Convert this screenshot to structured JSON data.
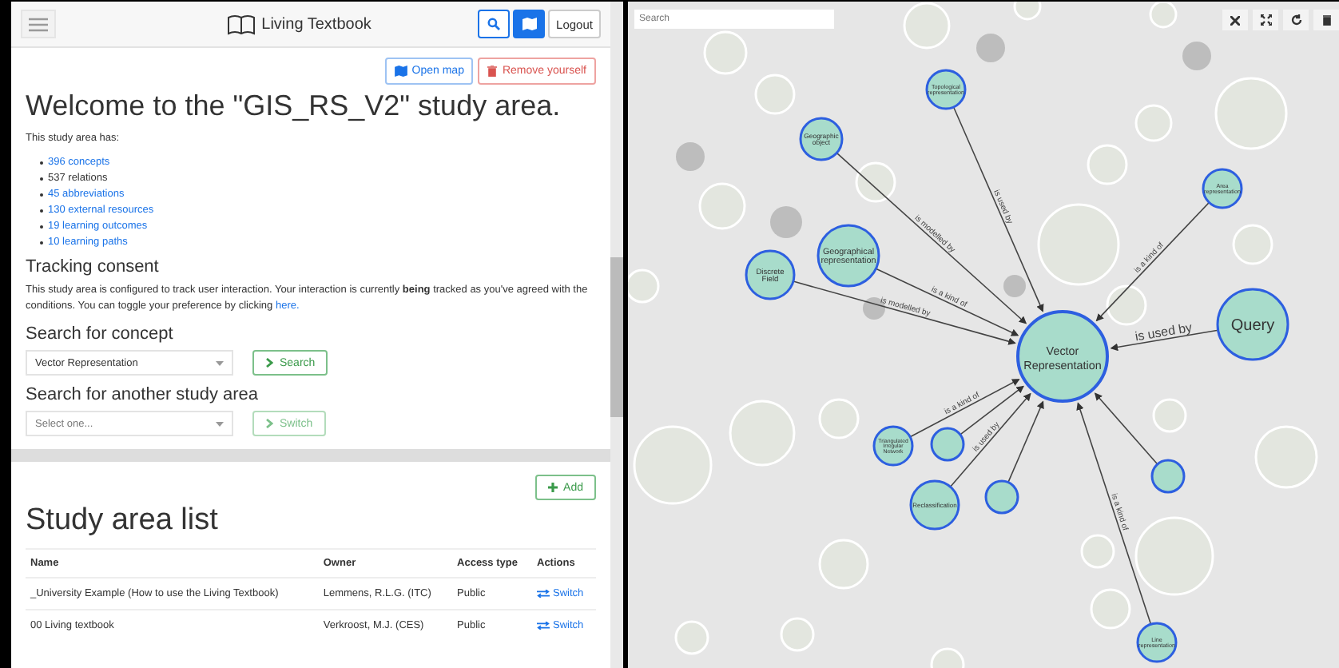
{
  "header": {
    "title": "Living Textbook",
    "buttons": [
      {
        "kind": "search",
        "selected": false
      },
      {
        "kind": "map",
        "selected": true
      },
      {
        "kind": "text",
        "label": "Logout",
        "selected": false
      }
    ]
  },
  "actions": [
    {
      "kind": "primary",
      "label": "Open map"
    },
    {
      "kind": "danger",
      "label": "Remove yourself"
    }
  ],
  "welcome_title": "Welcome to the \"GIS_RS_V2\" study area.",
  "intro": "This study area has:",
  "stats": [
    {
      "text": "396 concepts",
      "link": true
    },
    {
      "text": "537 relations",
      "link": false
    },
    {
      "text": "45 abbreviations",
      "link": true
    },
    {
      "text": "130 external resources",
      "link": true
    },
    {
      "text": "19 learning outcomes",
      "link": true
    },
    {
      "text": "10 learning paths",
      "link": true
    }
  ],
  "tracking": {
    "heading": "Tracking consent",
    "text": "This study area is configured to track user interaction. Your interaction is currently **being** tracked as you've agreed with the conditions. You can toggle your preference by clicking",
    "link": "here."
  },
  "concept_search": {
    "heading": "Search for concept",
    "value": "Vector Representation",
    "button": "Search"
  },
  "area_search": {
    "heading": "Search for another study area",
    "placeholder": "Select one...",
    "button": "Switch"
  },
  "study_list": {
    "add": "Add",
    "title": "Study area list",
    "columns": [
      "Name",
      "Owner",
      "Access type",
      "Actions"
    ],
    "rows": [
      {
        "name": "_University Example (How to use the Living Textbook)",
        "owner": "Lemmens, R.L.G. (ITC)",
        "access": "Public",
        "action": "Switch"
      },
      {
        "name": "00 Living textbook",
        "owner": "Verkroost, M.J. (CES)",
        "access": "Public",
        "action": "Switch"
      }
    ]
  },
  "graph": {
    "search_placeholder": "Search",
    "center": "Vector Representation",
    "nodes": [
      {
        "label": "Topological representation",
        "relation": "is used by"
      },
      {
        "label": "Geographic object",
        "relation": "is modelled by"
      },
      {
        "label": "Area representation",
        "relation": "is a kind of"
      },
      {
        "label": "Geographical representation",
        "relation": "is a kind of"
      },
      {
        "label": "Discrete Field",
        "relation": "is modelled by"
      },
      {
        "label": "Query",
        "relation": "is used by"
      },
      {
        "label": "Triangulated Irregular Network",
        "relation": "is a kind of"
      },
      {
        "label": "Reclassification",
        "relation": "is used by"
      },
      {
        "label": "Line representation",
        "relation": "is a kind of"
      }
    ]
  }
}
